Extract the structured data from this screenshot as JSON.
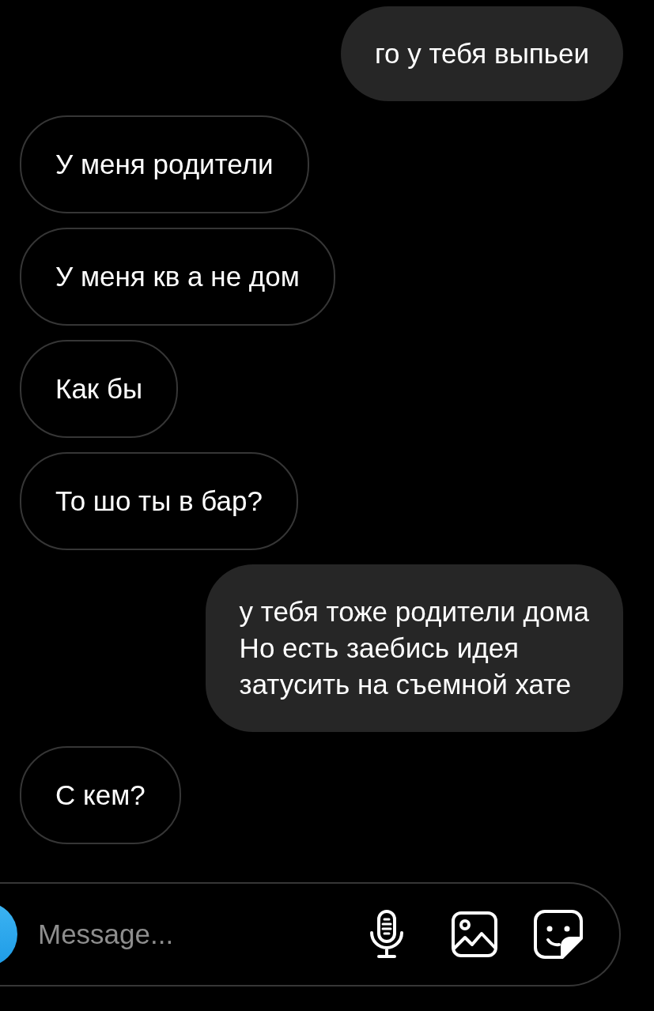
{
  "messages": [
    {
      "kind": "sent",
      "text": "го у тебя выпьеи"
    },
    {
      "kind": "received",
      "text": "У меня родители"
    },
    {
      "kind": "received",
      "text": "У меня кв а не дом"
    },
    {
      "kind": "received",
      "text": "Как бы"
    },
    {
      "kind": "received",
      "text": "То шо ты в бар?"
    },
    {
      "kind": "sent",
      "text": "у тебя тоже родители дома\nНо есть заебись идея\nзатусить на съемной хате"
    },
    {
      "kind": "received",
      "text": "С кем?"
    }
  ],
  "composer": {
    "placeholder": "Message..."
  }
}
